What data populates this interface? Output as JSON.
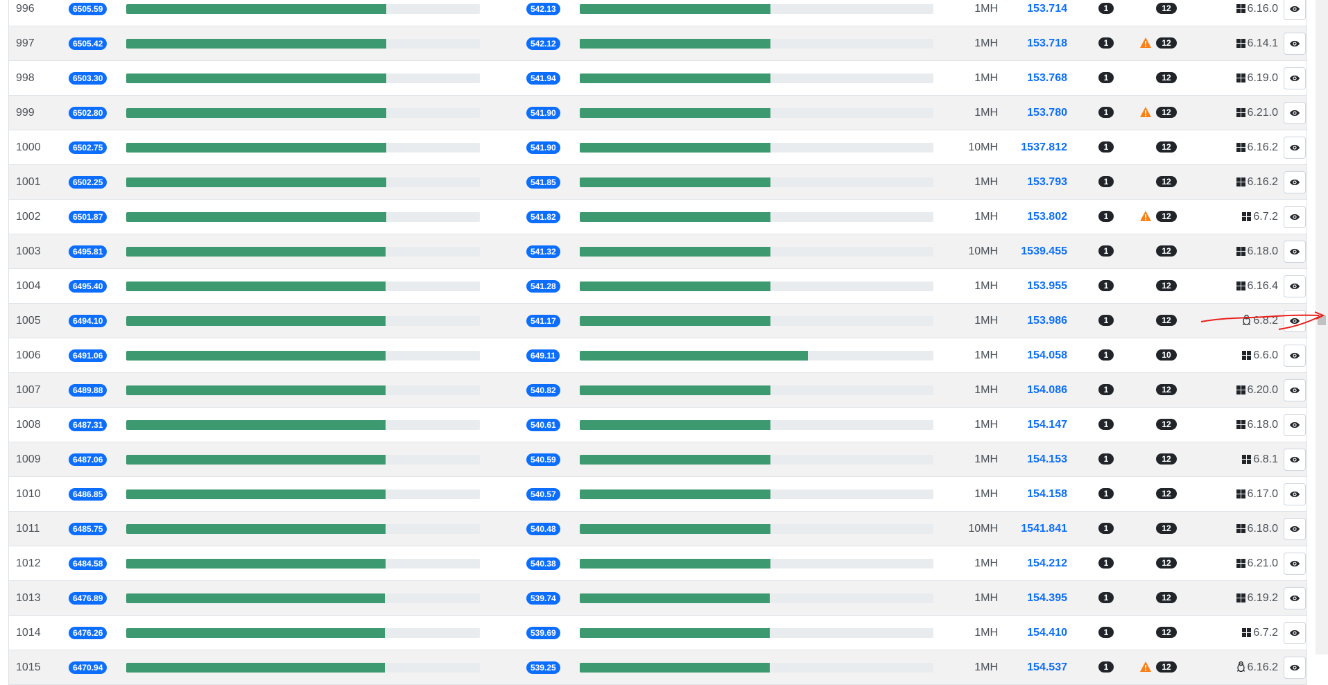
{
  "accent_color": "#0d6efd",
  "bar_color": "#3d9970",
  "rows": [
    {
      "rank": "996",
      "v1": "6505.59",
      "f1": 0.735,
      "v2": "542.13",
      "f2": 0.54,
      "size": "1MH",
      "price": "153.714",
      "c1": "1",
      "warn": false,
      "c2": "12",
      "os_icon": "windows-icon",
      "ver": "6.16.0"
    },
    {
      "rank": "997",
      "v1": "6505.42",
      "f1": 0.735,
      "v2": "542.12",
      "f2": 0.54,
      "size": "1MH",
      "price": "153.718",
      "c1": "1",
      "warn": true,
      "c2": "12",
      "os_icon": "windows-icon",
      "ver": "6.14.1"
    },
    {
      "rank": "998",
      "v1": "6503.30",
      "f1": 0.735,
      "v2": "541.94",
      "f2": 0.54,
      "size": "1MH",
      "price": "153.768",
      "c1": "1",
      "warn": false,
      "c2": "12",
      "os_icon": "windows-icon",
      "ver": "6.19.0"
    },
    {
      "rank": "999",
      "v1": "6502.80",
      "f1": 0.735,
      "v2": "541.90",
      "f2": 0.54,
      "size": "1MH",
      "price": "153.780",
      "c1": "1",
      "warn": true,
      "c2": "12",
      "os_icon": "windows-icon",
      "ver": "6.21.0"
    },
    {
      "rank": "1000",
      "v1": "6502.75",
      "f1": 0.735,
      "v2": "541.90",
      "f2": 0.54,
      "size": "10MH",
      "price": "1537.812",
      "c1": "1",
      "warn": false,
      "c2": "12",
      "os_icon": "windows-icon",
      "ver": "6.16.2"
    },
    {
      "rank": "1001",
      "v1": "6502.25",
      "f1": 0.735,
      "v2": "541.85",
      "f2": 0.54,
      "size": "1MH",
      "price": "153.793",
      "c1": "1",
      "warn": false,
      "c2": "12",
      "os_icon": "windows-icon",
      "ver": "6.16.2"
    },
    {
      "rank": "1002",
      "v1": "6501.87",
      "f1": 0.735,
      "v2": "541.82",
      "f2": 0.54,
      "size": "1MH",
      "price": "153.802",
      "c1": "1",
      "warn": true,
      "c2": "12",
      "os_icon": "windows-icon",
      "ver": "6.7.2"
    },
    {
      "rank": "1003",
      "v1": "6495.81",
      "f1": 0.734,
      "v2": "541.32",
      "f2": 0.539,
      "size": "10MH",
      "price": "1539.455",
      "c1": "1",
      "warn": false,
      "c2": "12",
      "os_icon": "windows-icon",
      "ver": "6.18.0"
    },
    {
      "rank": "1004",
      "v1": "6495.40",
      "f1": 0.734,
      "v2": "541.28",
      "f2": 0.539,
      "size": "1MH",
      "price": "153.955",
      "c1": "1",
      "warn": false,
      "c2": "12",
      "os_icon": "windows-icon",
      "ver": "6.16.4"
    },
    {
      "rank": "1005",
      "v1": "6494.10",
      "f1": 0.734,
      "v2": "541.17",
      "f2": 0.539,
      "size": "1MH",
      "price": "153.986",
      "c1": "1",
      "warn": false,
      "c2": "12",
      "os_icon": "linux-icon",
      "ver": "6.8.2"
    },
    {
      "rank": "1006",
      "v1": "6491.06",
      "f1": 0.733,
      "v2": "649.11",
      "f2": 0.646,
      "size": "1MH",
      "price": "154.058",
      "c1": "1",
      "warn": false,
      "c2": "10",
      "os_icon": "windows-icon",
      "ver": "6.6.0"
    },
    {
      "rank": "1007",
      "v1": "6489.88",
      "f1": 0.733,
      "v2": "540.82",
      "f2": 0.539,
      "size": "1MH",
      "price": "154.086",
      "c1": "1",
      "warn": false,
      "c2": "12",
      "os_icon": "windows-icon",
      "ver": "6.20.0"
    },
    {
      "rank": "1008",
      "v1": "6487.31",
      "f1": 0.733,
      "v2": "540.61",
      "f2": 0.539,
      "size": "1MH",
      "price": "154.147",
      "c1": "1",
      "warn": false,
      "c2": "12",
      "os_icon": "windows-icon",
      "ver": "6.18.0"
    },
    {
      "rank": "1009",
      "v1": "6487.06",
      "f1": 0.733,
      "v2": "540.59",
      "f2": 0.539,
      "size": "1MH",
      "price": "154.153",
      "c1": "1",
      "warn": false,
      "c2": "12",
      "os_icon": "windows-icon",
      "ver": "6.8.1"
    },
    {
      "rank": "1010",
      "v1": "6486.85",
      "f1": 0.733,
      "v2": "540.57",
      "f2": 0.539,
      "size": "1MH",
      "price": "154.158",
      "c1": "1",
      "warn": false,
      "c2": "12",
      "os_icon": "windows-icon",
      "ver": "6.17.0"
    },
    {
      "rank": "1011",
      "v1": "6485.75",
      "f1": 0.733,
      "v2": "540.48",
      "f2": 0.539,
      "size": "10MH",
      "price": "1541.841",
      "c1": "1",
      "warn": false,
      "c2": "12",
      "os_icon": "windows-icon",
      "ver": "6.18.0"
    },
    {
      "rank": "1012",
      "v1": "6484.58",
      "f1": 0.733,
      "v2": "540.38",
      "f2": 0.539,
      "size": "1MH",
      "price": "154.212",
      "c1": "1",
      "warn": false,
      "c2": "12",
      "os_icon": "windows-icon",
      "ver": "6.21.0"
    },
    {
      "rank": "1013",
      "v1": "6476.89",
      "f1": 0.732,
      "v2": "539.74",
      "f2": 0.538,
      "size": "1MH",
      "price": "154.395",
      "c1": "1",
      "warn": false,
      "c2": "12",
      "os_icon": "windows-icon",
      "ver": "6.19.2"
    },
    {
      "rank": "1014",
      "v1": "6476.26",
      "f1": 0.732,
      "v2": "539.69",
      "f2": 0.538,
      "size": "1MH",
      "price": "154.410",
      "c1": "1",
      "warn": false,
      "c2": "12",
      "os_icon": "windows-icon",
      "ver": "6.7.2"
    },
    {
      "rank": "1015",
      "v1": "6470.94",
      "f1": 0.731,
      "v2": "539.25",
      "f2": 0.537,
      "size": "1MH",
      "price": "154.537",
      "c1": "1",
      "warn": true,
      "c2": "12",
      "os_icon": "linux-icon",
      "ver": "6.16.2"
    }
  ]
}
